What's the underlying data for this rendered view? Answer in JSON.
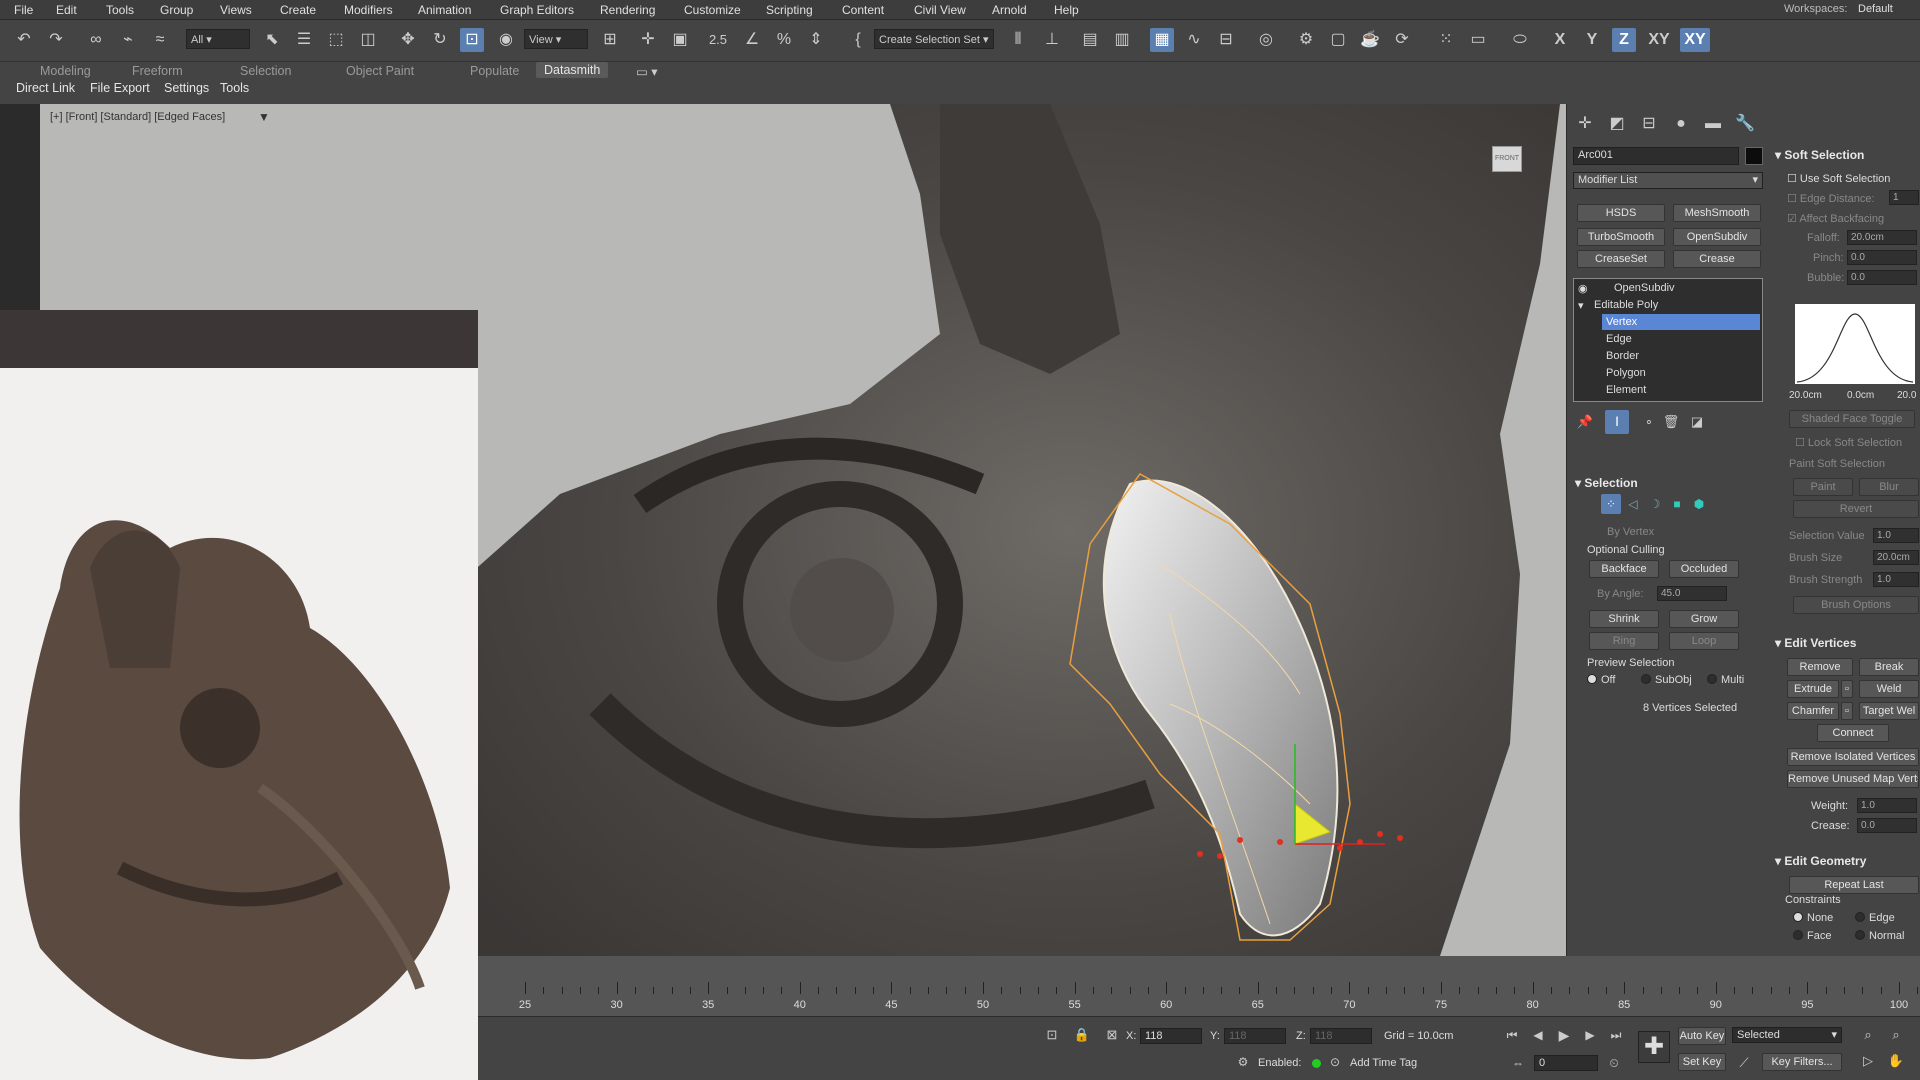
{
  "menu": [
    "File",
    "Edit",
    "Tools",
    "Group",
    "Views",
    "Create",
    "Modifiers",
    "Animation",
    "Graph Editors",
    "Rendering",
    "Customize",
    "Scripting",
    "Content",
    "Civil View",
    "Arnold",
    "Help"
  ],
  "workspaces_label": "Workspaces:",
  "workspace": "Default",
  "toolbar": {
    "filter": "All",
    "refcoord": "View",
    "selset": "Create Selection Set",
    "snap_label": "2.5",
    "axes": [
      "X",
      "Y",
      "Z",
      "XY",
      "XY"
    ]
  },
  "ribbon": {
    "tabs": [
      "Modeling",
      "Freeform",
      "Selection",
      "Object Paint",
      "Populate",
      "Datasmith"
    ],
    "row2": [
      "Direct Link",
      "File Export",
      "Settings",
      "Tools"
    ]
  },
  "viewport": {
    "label": "[+] [Front] [Standard] [Edged Faces]",
    "viewcube": "FRONT"
  },
  "cmd": {
    "object_name": "Arc001",
    "modifier_list": "Modifier List",
    "mod_buttons": [
      "HSDS",
      "MeshSmooth",
      "TurboSmooth",
      "OpenSubdiv",
      "CreaseSet",
      "Crease"
    ],
    "stack": [
      "OpenSubdiv",
      "Editable Poly",
      "Vertex",
      "Edge",
      "Border",
      "Polygon",
      "Element"
    ]
  },
  "selection": {
    "title": "Selection",
    "by_vertex": "By Vertex",
    "optional_culling": "Optional Culling",
    "backface": "Backface",
    "occluded": "Occluded",
    "by_angle": "By Angle:",
    "by_angle_val": "45.0",
    "shrink": "Shrink",
    "grow": "Grow",
    "ring": "Ring",
    "loop": "Loop",
    "preview": "Preview Selection",
    "off": "Off",
    "subobj": "SubObj",
    "multi": "Multi",
    "status": "8 Vertices Selected"
  },
  "soft": {
    "title": "Soft Selection",
    "use": "Use Soft Selection",
    "edge_distance": "Edge Distance:",
    "edge_distance_val": "1",
    "affect_backfacing": "Affect Backfacing",
    "falloff": "Falloff:",
    "falloff_val": "20.0cm",
    "pinch": "Pinch:",
    "pinch_val": "0.0",
    "bubble": "Bubble:",
    "bubble_val": "0.0",
    "curve_labels": [
      "20.0cm",
      "0.0cm",
      "20.0"
    ],
    "shaded_face": "Shaded Face Toggle",
    "lock": "Lock Soft Selection",
    "paint_soft": "Paint Soft Selection",
    "paint": "Paint",
    "blur": "Blur",
    "revert": "Revert",
    "sel_value": "Selection Value",
    "sel_value_val": "1.0",
    "brush_size": "Brush Size",
    "brush_size_val": "20.0cm",
    "brush_strength": "Brush Strength",
    "brush_strength_val": "1.0",
    "brush_options": "Brush Options"
  },
  "edit_vertices": {
    "title": "Edit Vertices",
    "remove": "Remove",
    "break": "Break",
    "extrude": "Extrude",
    "weld": "Weld",
    "chamfer": "Chamfer",
    "target_weld": "Target Wel",
    "connect": "Connect",
    "remove_isolated": "Remove Isolated Vertices",
    "remove_unused": "Remove Unused Map Verts",
    "weight": "Weight:",
    "weight_val": "1.0",
    "crease": "Crease:",
    "crease_val": "0.0"
  },
  "edit_geometry": {
    "title": "Edit Geometry",
    "repeat_last": "Repeat Last",
    "constraints": "Constraints",
    "none": "None",
    "edge": "Edge",
    "face": "Face",
    "normal": "Normal"
  },
  "timeline": {
    "ticks": [
      "25",
      "30",
      "35",
      "40",
      "45",
      "50",
      "55",
      "60",
      "65",
      "70",
      "75",
      "80",
      "85",
      "90",
      "95",
      "100"
    ]
  },
  "status": {
    "x_label": "X:",
    "x_val": "118",
    "y_label": "Y:",
    "y_val": "118",
    "z_label": "Z:",
    "z_val": "118",
    "grid": "Grid = 10.0cm",
    "enabled": "Enabled:",
    "add_time_tag": "Add Time Tag",
    "auto_key": "Auto Key",
    "selected": "Selected",
    "set_key": "Set Key",
    "key_filters": "Key Filters...",
    "frame": "0"
  },
  "colors": {
    "accent": "#5b7fb0",
    "selected_row": "#5a86d6",
    "wire": "#e8a040",
    "vertex": "#e03020"
  }
}
